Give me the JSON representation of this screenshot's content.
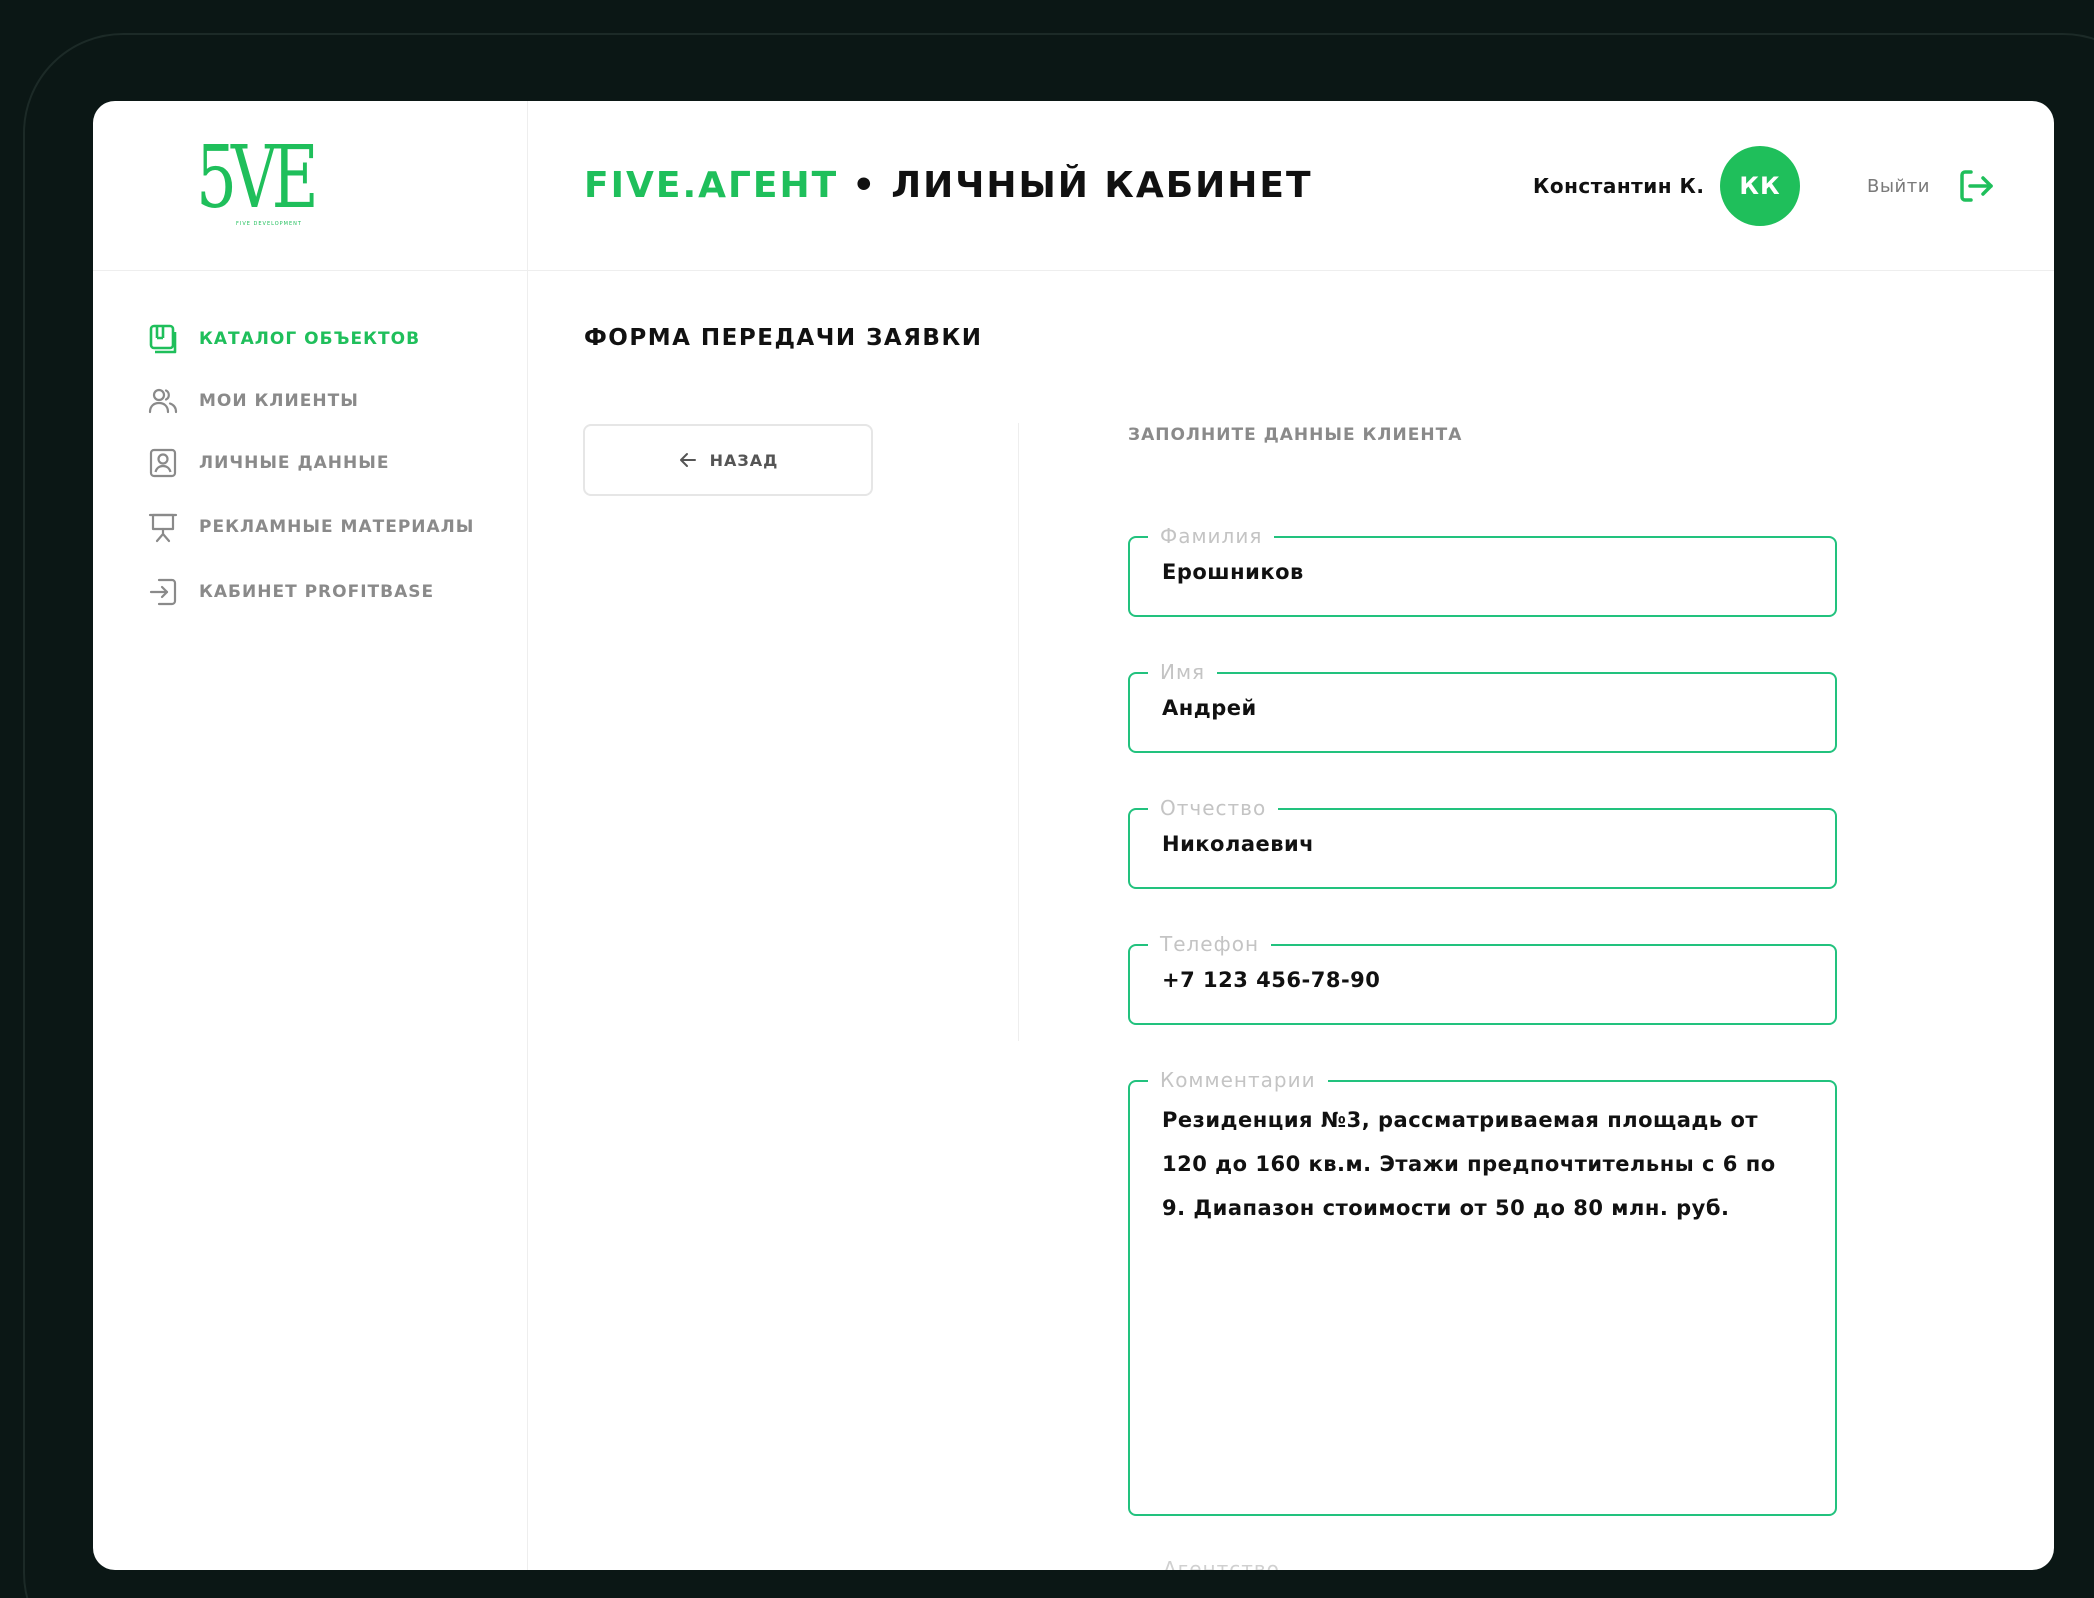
{
  "app": {
    "logo_text": "5VE",
    "logo_sub": "FIVE DEVELOPMENT",
    "brand": "FIVE.АГЕНТ",
    "separator": "•",
    "title": "ЛИЧНЫЙ КАБИНЕТ"
  },
  "user": {
    "name": "Константин К.",
    "initials": "КК",
    "logout_label": "Выйти"
  },
  "sidebar": {
    "items": [
      {
        "label": "КАТАЛОГ ОБЪЕКТОВ",
        "icon": "catalog-icon",
        "active": true
      },
      {
        "label": "МОИ КЛИЕНТЫ",
        "icon": "users-icon",
        "active": false
      },
      {
        "label": "ЛИЧНЫЕ ДАННЫЕ",
        "icon": "profile-icon",
        "active": false
      },
      {
        "label": "РЕКЛАМНЫЕ МАТЕРИАЛЫ",
        "icon": "presentation-icon",
        "active": false
      },
      {
        "label": "КАБИНЕТ PROFITBASE",
        "icon": "login-icon",
        "active": false
      }
    ]
  },
  "main": {
    "page_title": "ФОРМА ПЕРЕДАЧИ ЗАЯВКИ",
    "back_label": "НАЗАД",
    "form_heading": "ЗАПОЛНИТЕ ДАННЫЕ КЛИЕНТА",
    "fields": {
      "last_name": {
        "label": "Фамилия",
        "value": "Ерошников"
      },
      "first_name": {
        "label": "Имя",
        "value": "Андрей"
      },
      "patronymic": {
        "label": "Отчество",
        "value": "Николаевич"
      },
      "phone": {
        "label": "Телефон",
        "value": "+7 123 456-78-90"
      },
      "comment": {
        "label": "Комментарии",
        "value": "Резиденция №3, рассматриваемая площадь от 120 до 160 кв.м. Этажи предпочтительны с 6 по 9. Диапазон стоимости от 50 до 80 млн. руб."
      }
    },
    "cutoff_label": "Агентство"
  },
  "colors": {
    "accent": "#1fbf5b",
    "field_border": "#22c27e",
    "background": "#0b1715",
    "muted_text": "#8a8a8a"
  }
}
